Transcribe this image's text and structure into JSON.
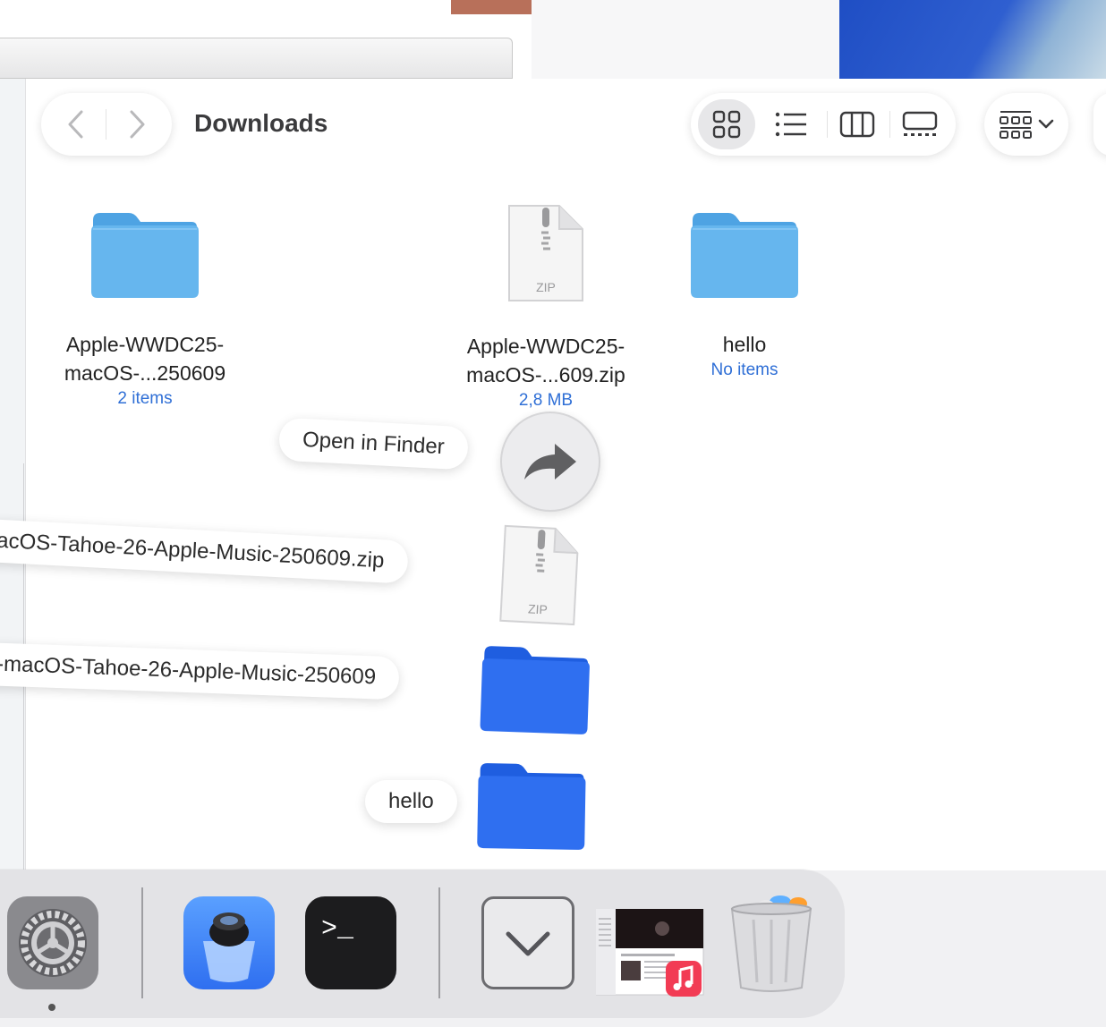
{
  "window": {
    "title": "Downloads"
  },
  "toolbar": {
    "back_icon": "chevron-left-icon",
    "forward_icon": "chevron-right-icon",
    "views": [
      "icon-view-icon",
      "list-view-icon",
      "column-view-icon",
      "gallery-view-icon"
    ],
    "active_view": "icon-view-icon",
    "group_icon": "group-grid-icon"
  },
  "files": [
    {
      "name_line1": "Apple-WWDC25-",
      "name_line2": "macOS-...250609",
      "meta": "2 items",
      "icon": "folder-icon"
    },
    {
      "name_line1": "Apple-WWDC25-",
      "name_line2": "macOS-...609.zip",
      "meta": "2,8 MB",
      "icon": "zip-file-icon",
      "badge": "ZIP"
    },
    {
      "name_line1": "hello",
      "name_line2": "",
      "meta": "No items",
      "icon": "folder-icon"
    }
  ],
  "stack": {
    "open_label": "Open in Finder",
    "items": [
      {
        "label": "acOS-Tahoe-26-Apple-Music-250609.zip",
        "icon": "zip-file-icon",
        "badge": "ZIP"
      },
      {
        "label": "-macOS-Tahoe-26-Apple-Music-250609",
        "icon": "folder-icon"
      },
      {
        "label": "hello",
        "icon": "folder-icon"
      }
    ]
  },
  "dock": {
    "apps": [
      "system-settings-icon",
      "preview-icon",
      "terminal-icon",
      "downloads-stack-icon",
      "music-window-thumbnail",
      "trash-icon"
    ],
    "terminal_prompt": ">_"
  },
  "colors": {
    "accent": "#2f6fd6",
    "folder": "#5fb0ea",
    "folder_stack": "#2f6ff0"
  }
}
